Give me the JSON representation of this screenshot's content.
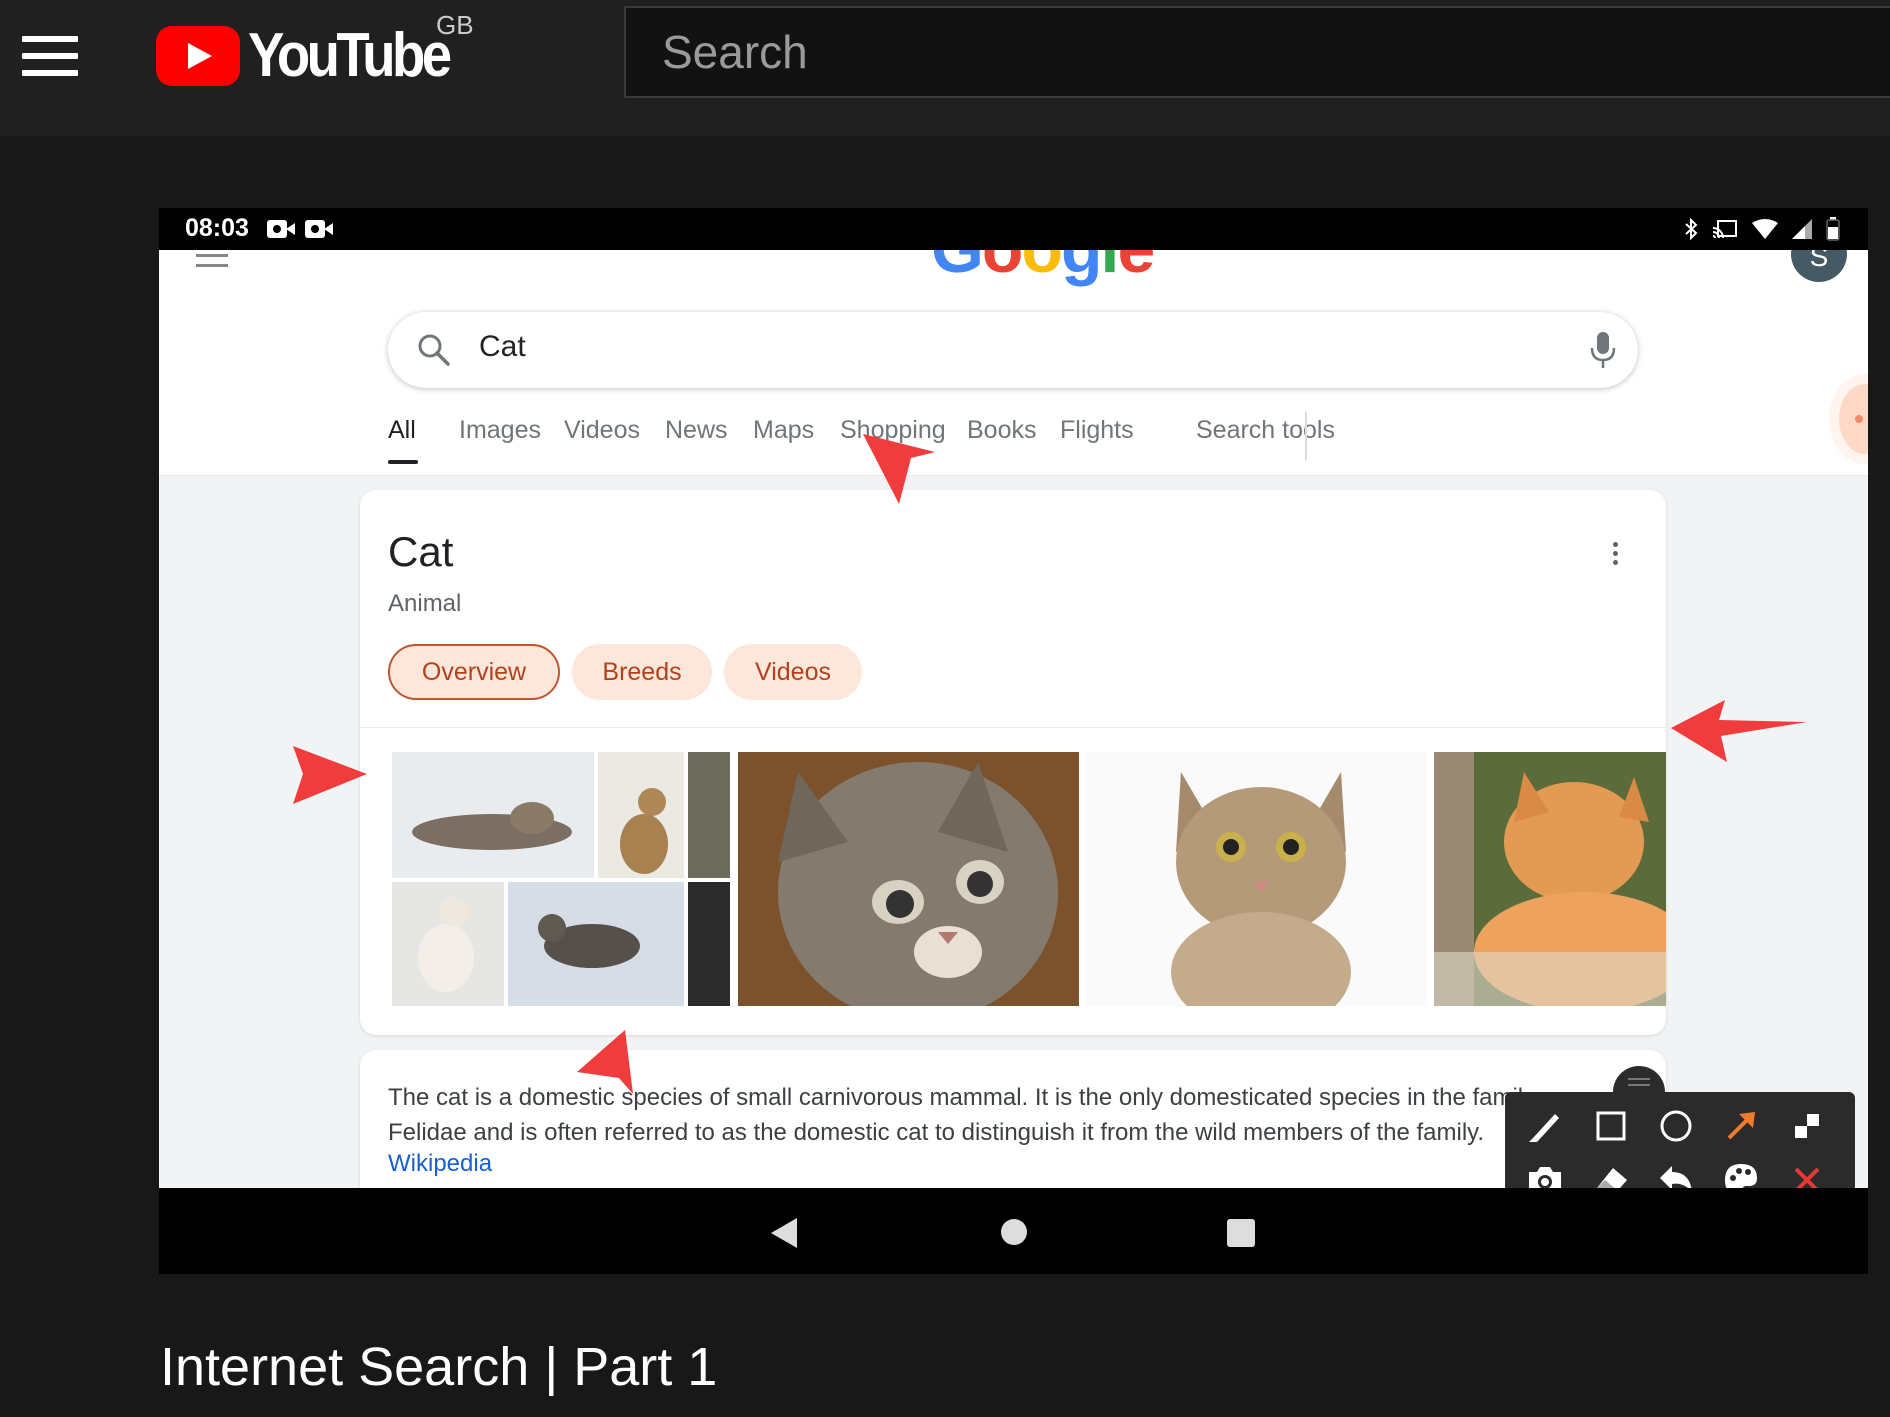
{
  "youtube": {
    "logo_text": "YouTube",
    "country_code": "GB",
    "search_placeholder": "Search",
    "menu_icon": "hamburger-menu-icon",
    "brand_color": "#ff0000"
  },
  "video": {
    "title": "Internet Search | Part 1"
  },
  "phone": {
    "status_bar": {
      "time": "08:03",
      "icons_left": [
        "video-camera-icon",
        "video-camera-icon"
      ],
      "icons_right": [
        "bluetooth-icon",
        "cast-icon",
        "wifi-icon",
        "signal-icon",
        "battery-icon"
      ]
    },
    "google": {
      "logo_text": "Google",
      "logo_colors": [
        "#4285f4",
        "#ea4335",
        "#fbbc05",
        "#4285f4",
        "#34a853",
        "#ea4335"
      ],
      "avatar_letter": "S",
      "search_query": "Cat",
      "tabs": [
        {
          "label": "All",
          "active": true
        },
        {
          "label": "Images",
          "active": false
        },
        {
          "label": "Videos",
          "active": false
        },
        {
          "label": "News",
          "active": false
        },
        {
          "label": "Maps",
          "active": false
        },
        {
          "label": "Shopping",
          "active": false
        },
        {
          "label": "Books",
          "active": false
        },
        {
          "label": "Flights",
          "active": false
        }
      ],
      "search_tools_label": "Search tools",
      "knowledge_panel": {
        "title": "Cat",
        "subtitle": "Animal",
        "chips": [
          {
            "label": "Overview",
            "active": true
          },
          {
            "label": "Breeds",
            "active": false
          },
          {
            "label": "Videos",
            "active": false
          }
        ],
        "images": [
          "cat-collage-image",
          "tabby-kitten-image",
          "tabby-cat-front-image",
          "orange-cat-sleeping-image"
        ]
      },
      "description": {
        "line1": "The cat is a domestic species of small carnivorous mammal. It is the only domesticated species in the family",
        "line2": "Felidae and is often referred to as the domestic cat to distinguish it from the wild members of the family.",
        "source_link": "Wikipedia"
      }
    },
    "annotation_color": "#f03c3c",
    "drawing_toolbar": {
      "tools_row1": [
        "pen-icon",
        "rectangle-icon",
        "circle-icon",
        "arrow-icon",
        "mosaic-icon"
      ],
      "tools_row2": [
        "camera-icon",
        "eraser-icon",
        "undo-icon",
        "palette-icon",
        "close-icon"
      ],
      "arrow_tool_color": "#f07c2e",
      "close_color": "#e53935"
    },
    "nav_buttons": [
      "back-icon",
      "home-icon",
      "recents-icon"
    ]
  }
}
